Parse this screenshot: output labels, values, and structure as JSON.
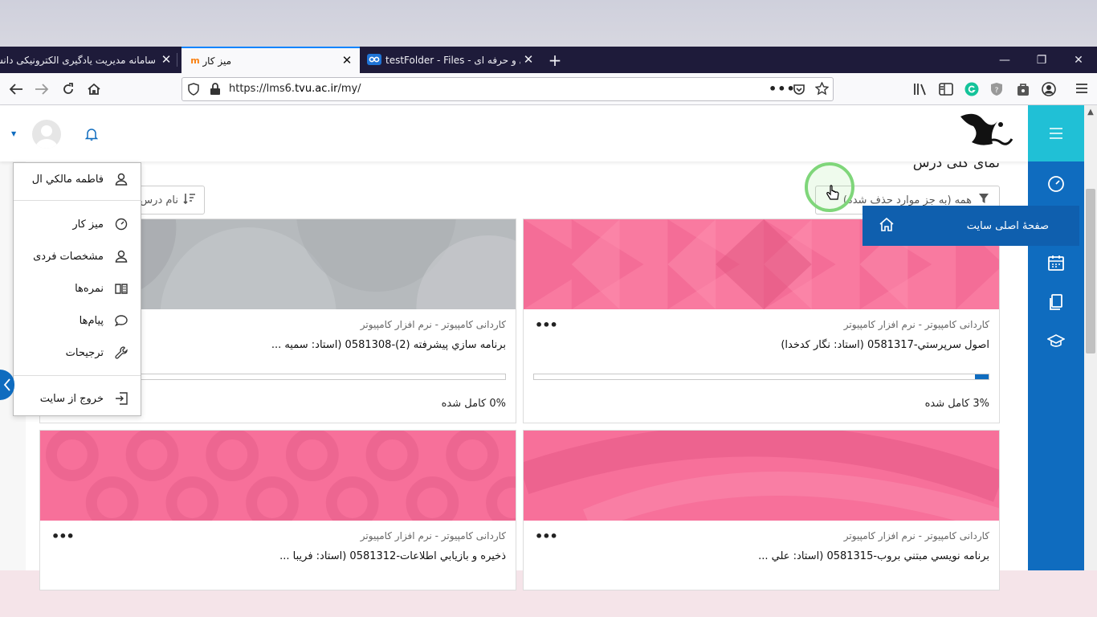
{
  "browser": {
    "tabs": [
      {
        "title": "سامانه مدیریت یادگیری الکترونیکی دانشگاه فنی و حرفه ای",
        "active": false
      },
      {
        "title": "میز کار",
        "active": true,
        "favicon": "m"
      },
      {
        "title": "testFolder - Files - دانشگاه فنی و حرفه ای",
        "active": false
      }
    ],
    "url_prefix": "https://lms6.",
    "url_domain": "tvu.ac.ir",
    "url_path": "/my/"
  },
  "header": {
    "page_title": "نمای کلی درس"
  },
  "filters": {
    "all_label": "همه (به جز موارد حذف شده)",
    "sort_label": "نام درس"
  },
  "user_menu": {
    "name": "فاطمه مالکي ال",
    "items": [
      {
        "label": "میز کار",
        "icon": "dashboard-icon"
      },
      {
        "label": "مشخصات فردی",
        "icon": "user-icon"
      },
      {
        "label": "نمره‌ها",
        "icon": "grades-icon"
      },
      {
        "label": "پیام‌ها",
        "icon": "chat-icon"
      },
      {
        "label": "ترجیحات",
        "icon": "wrench-icon"
      }
    ],
    "logout": "خروج از سایت"
  },
  "tooltip": {
    "label": "صفحهٔ اصلی سایت"
  },
  "courses": [
    {
      "category": "کاردانی کامپیوتر - نرم افزار کامپیوتر",
      "name": "اصول سرپرستي-0581317 (استاد: نگار كدخدا)",
      "progress": 3,
      "percent_label": "3% کامل شده",
      "color": "pink"
    },
    {
      "category": "کاردانی کامپیوتر - نرم افزار کامپیوتر",
      "name": "برنامه سازي پيشرفته (2)-0581308 (استاد: سميه ...",
      "progress": 0,
      "percent_label": "0% کامل شده",
      "color": "gray"
    },
    {
      "category": "کاردانی کامپیوتر - نرم افزار کامپیوتر",
      "name": "برنامه نويسي مبتني بروب-0581315 (استاد: علي ...",
      "color": "pink"
    },
    {
      "category": "کاردانی کامپیوتر - نرم افزار کامپیوتر",
      "name": "ذخيره و بازيابي اطلاعات-0581312 (استاد: فريبا ...",
      "color": "pink"
    }
  ],
  "colors": {
    "primary": "#0f6cbf",
    "sidebar_top": "#20c0d6",
    "tab_bar": "#1e1b3a",
    "pink": "#f96e98",
    "gray": "#a9adb0"
  }
}
